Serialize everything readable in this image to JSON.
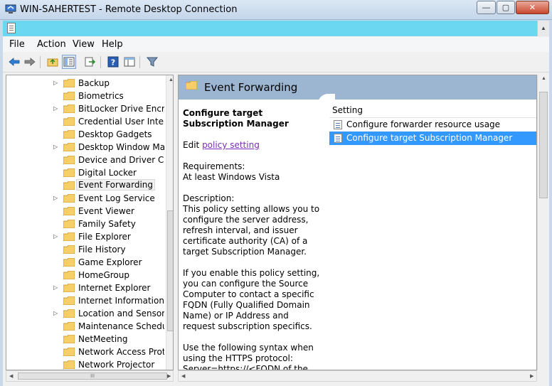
{
  "window": {
    "title": "WIN-SAHERTEST - Remote Desktop Connection",
    "minimize_label": "—",
    "maximize_label": "▢",
    "close_label": "✕"
  },
  "menubar": {
    "items": [
      "File",
      "Action",
      "View",
      "Help"
    ]
  },
  "toolbar": {
    "icons": [
      "back-arrow-icon",
      "forward-arrow-icon",
      "up-folder-icon",
      "show-hide-tree-icon",
      "export-list-icon",
      "help-icon",
      "extended-view-icon",
      "filter-icon"
    ]
  },
  "tree": {
    "items": [
      {
        "label": "Backup",
        "expandable": true
      },
      {
        "label": "Biometrics",
        "expandable": false
      },
      {
        "label": "BitLocker Drive Encryption",
        "expandable": true
      },
      {
        "label": "Credential User Interface",
        "expandable": false
      },
      {
        "label": "Desktop Gadgets",
        "expandable": false
      },
      {
        "label": "Desktop Window Manager",
        "expandable": true
      },
      {
        "label": "Device and Driver Compatibility",
        "expandable": false
      },
      {
        "label": "Digital Locker",
        "expandable": false
      },
      {
        "label": "Event Forwarding",
        "expandable": false,
        "selected": true
      },
      {
        "label": "Event Log Service",
        "expandable": true
      },
      {
        "label": "Event Viewer",
        "expandable": false
      },
      {
        "label": "Family Safety",
        "expandable": false
      },
      {
        "label": "File Explorer",
        "expandable": true
      },
      {
        "label": "File History",
        "expandable": false
      },
      {
        "label": "Game Explorer",
        "expandable": false
      },
      {
        "label": "HomeGroup",
        "expandable": false
      },
      {
        "label": "Internet Explorer",
        "expandable": true
      },
      {
        "label": "Internet Information Services",
        "expandable": false
      },
      {
        "label": "Location and Sensors",
        "expandable": true
      },
      {
        "label": "Maintenance Scheduler",
        "expandable": false
      },
      {
        "label": "NetMeeting",
        "expandable": false
      },
      {
        "label": "Network Access Protection",
        "expandable": false
      },
      {
        "label": "Network Projector",
        "expandable": false
      }
    ]
  },
  "right": {
    "header": "Event Forwarding",
    "description": {
      "title": "Configure target Subscription Manager",
      "edit_prefix": "Edit ",
      "edit_link": "policy setting",
      "requirements_label": "Requirements:",
      "requirements_value": "At least Windows Vista",
      "description_label": "Description:",
      "para1": "This policy setting allows you to configure the server address, refresh interval, and issuer certificate authority (CA) of a target Subscription Manager.",
      "para2": "If you enable this policy setting, you can configure the Source Computer to contact a specific FQDN (Fully Qualified Domain Name) or IP Address and request subscription specifics.",
      "para3": "Use the following syntax when using the HTTPS protocol:",
      "para4": "Server=https://<FQDN of the"
    },
    "list": {
      "header": "Setting",
      "rows": [
        {
          "label": "Configure forwarder resource usage",
          "selected": false
        },
        {
          "label": "Configure target Subscription Manager",
          "selected": true
        }
      ]
    }
  },
  "scroll": {
    "grip": "III"
  },
  "colors": {
    "inner_titlebar": "#6bd7f1",
    "header_band": "#9cb6d2",
    "selection": "#3399ff",
    "link": "#7a2db7",
    "folder": "#f6cf6a"
  }
}
